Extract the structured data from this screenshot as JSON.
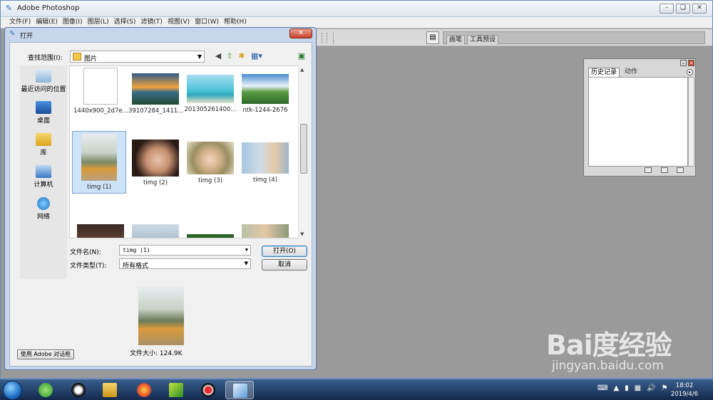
{
  "app": {
    "title": "Adobe Photoshop"
  },
  "menubar": [
    "文件(F)",
    "编辑(E)",
    "图像(I)",
    "图层(L)",
    "选择(S)",
    "滤镜(T)",
    "视图(V)",
    "窗口(W)",
    "帮助(H)"
  ],
  "options_bar": {
    "tabs": [
      "画笔",
      "工具预设"
    ]
  },
  "history_panel": {
    "tabs": [
      "历史记录",
      "动作"
    ]
  },
  "dialog": {
    "title": "打开",
    "look_in_label": "查找范围(I):",
    "look_in_value": "图片",
    "places": [
      "最近访问的位置",
      "桌面",
      "库",
      "计算机",
      "网络"
    ],
    "files": [
      {
        "name": "1440x900_2d7e...",
        "kind": "blank"
      },
      {
        "name": "39107284_1411...",
        "kind": "sunset"
      },
      {
        "name": "201305261400...",
        "kind": "island"
      },
      {
        "name": "ntk-1244-2676",
        "kind": "landscape"
      },
      {
        "name": "timg (1)",
        "kind": "person-back",
        "selected": true
      },
      {
        "name": "timg (2)",
        "kind": "face"
      },
      {
        "name": "timg (3)",
        "kind": "hat"
      },
      {
        "name": "timg (4)",
        "kind": "outdoor"
      },
      {
        "name": "",
        "kind": "dark"
      },
      {
        "name": "",
        "kind": "sky"
      },
      {
        "name": "",
        "kind": "green"
      },
      {
        "name": "",
        "kind": "portrait"
      }
    ],
    "filename_label": "文件名(N):",
    "filename_value": "timg (1)",
    "filetype_label": "文件类型(T):",
    "filetype_value": "所有格式",
    "open_button": "打开(O)",
    "cancel_button": "取消",
    "file_size": "文件大小: 124.9K",
    "adobe_dialog_button": "使用 Adobe 对话框"
  },
  "taskbar": {
    "apps": [
      "browser-360",
      "qq",
      "file-explorer",
      "firefox",
      "media-player",
      "recorder",
      "photoshop"
    ],
    "active_app": "photoshop",
    "time": "18:02",
    "date": "2019/4/6"
  },
  "watermark": {
    "logo": "Bai度经验",
    "url": "jingyan.baidu.com"
  },
  "colors": {
    "titlebar": "#dfe6ef",
    "workspace": "#9a9a9a",
    "selection": "#cde3f7",
    "taskbar": "#13294d",
    "close": "#c8402a"
  }
}
